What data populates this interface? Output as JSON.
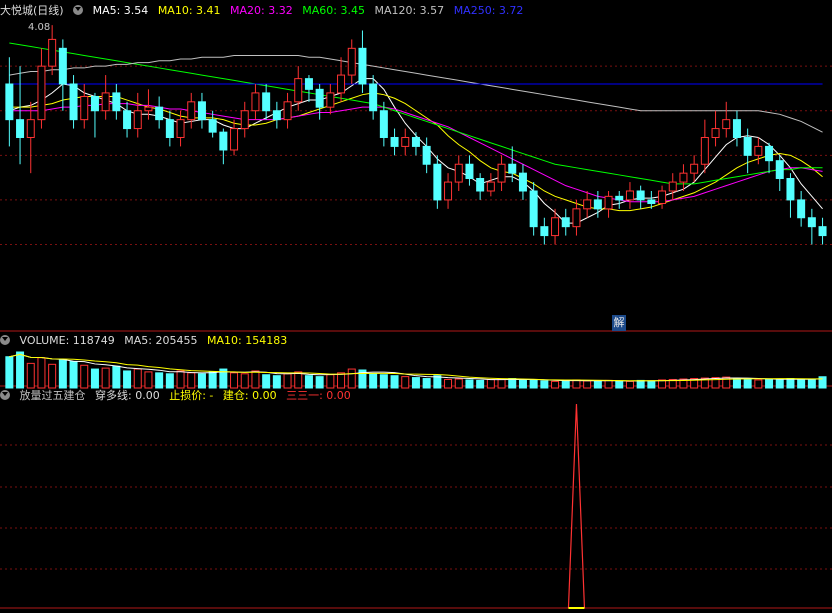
{
  "header": {
    "stock_name": "大悦城(日线)",
    "ma5": "MA5: 3.54",
    "ma10": "MA10: 3.41",
    "ma20": "MA20: 3.32",
    "ma60": "MA60: 3.45",
    "ma120": "MA120: 3.57",
    "ma250": "MA250: 3.72",
    "high_label": "4.08"
  },
  "volume_header": {
    "volume": "VOLUME: 118749",
    "ma5": "MA5: 205455",
    "ma10": "MA10: 154183"
  },
  "indicator_header": {
    "name": "放量过五建仓",
    "cross": "穿多线: 0.00",
    "stop": "止损价: -",
    "build": "建仓: 0.00",
    "three": "三三一: 0.00"
  },
  "badge": "解",
  "colors": {
    "up": "#ff3232",
    "down": "#54ffff",
    "ma5": "#ffffff",
    "ma10": "#ffff00",
    "ma20": "#ff00ff",
    "ma60": "#00ff00",
    "ma120": "#c0c0c0",
    "ma250": "#0000ff",
    "grid": "#7a1010",
    "indicator": "#ff3232"
  },
  "chart_data": {
    "type": "candlestick",
    "price_axis": {
      "ymin": 2.55,
      "ymax": 4.12
    },
    "price_grid_values": [
      3.85,
      3.6,
      3.35,
      3.1,
      2.85
    ],
    "candles": [
      [
        3.75,
        3.55,
        3.9,
        3.4
      ],
      [
        3.55,
        3.45,
        3.85,
        3.3
      ],
      [
        3.45,
        3.55,
        3.65,
        3.25
      ],
      [
        3.55,
        3.85,
        3.95,
        3.5
      ],
      [
        3.85,
        4.0,
        4.08,
        3.8
      ],
      [
        3.95,
        3.75,
        4.0,
        3.6
      ],
      [
        3.75,
        3.55,
        3.8,
        3.5
      ],
      [
        3.55,
        3.68,
        3.75,
        3.5
      ],
      [
        3.68,
        3.6,
        3.7,
        3.45
      ],
      [
        3.6,
        3.7,
        3.8,
        3.55
      ],
      [
        3.7,
        3.6,
        3.75,
        3.55
      ],
      [
        3.6,
        3.5,
        3.65,
        3.45
      ],
      [
        3.5,
        3.6,
        3.7,
        3.45
      ],
      [
        3.6,
        3.62,
        3.72,
        3.55
      ],
      [
        3.62,
        3.55,
        3.68,
        3.5
      ],
      [
        3.55,
        3.45,
        3.6,
        3.4
      ],
      [
        3.45,
        3.55,
        3.6,
        3.4
      ],
      [
        3.55,
        3.65,
        3.7,
        3.5
      ],
      [
        3.65,
        3.55,
        3.7,
        3.5
      ],
      [
        3.55,
        3.48,
        3.6,
        3.45
      ],
      [
        3.48,
        3.38,
        3.5,
        3.3
      ],
      [
        3.38,
        3.5,
        3.55,
        3.35
      ],
      [
        3.5,
        3.6,
        3.65,
        3.45
      ],
      [
        3.6,
        3.7,
        3.75,
        3.55
      ],
      [
        3.7,
        3.6,
        3.75,
        3.55
      ],
      [
        3.6,
        3.55,
        3.65,
        3.5
      ],
      [
        3.55,
        3.65,
        3.7,
        3.5
      ],
      [
        3.65,
        3.78,
        3.85,
        3.6
      ],
      [
        3.78,
        3.72,
        3.8,
        3.65
      ],
      [
        3.72,
        3.62,
        3.75,
        3.55
      ],
      [
        3.62,
        3.7,
        3.75,
        3.58
      ],
      [
        3.7,
        3.8,
        3.9,
        3.65
      ],
      [
        3.8,
        3.95,
        4.0,
        3.75
      ],
      [
        3.95,
        3.75,
        4.05,
        3.7
      ],
      [
        3.75,
        3.6,
        3.8,
        3.55
      ],
      [
        3.6,
        3.45,
        3.65,
        3.4
      ],
      [
        3.45,
        3.4,
        3.5,
        3.35
      ],
      [
        3.4,
        3.45,
        3.5,
        3.35
      ],
      [
        3.45,
        3.4,
        3.48,
        3.35
      ],
      [
        3.4,
        3.3,
        3.45,
        3.25
      ],
      [
        3.3,
        3.1,
        3.35,
        3.05
      ],
      [
        3.1,
        3.2,
        3.25,
        3.05
      ],
      [
        3.2,
        3.3,
        3.35,
        3.15
      ],
      [
        3.3,
        3.22,
        3.35,
        3.18
      ],
      [
        3.22,
        3.15,
        3.25,
        3.1
      ],
      [
        3.15,
        3.2,
        3.25,
        3.12
      ],
      [
        3.2,
        3.3,
        3.35,
        3.15
      ],
      [
        3.3,
        3.25,
        3.4,
        3.2
      ],
      [
        3.25,
        3.15,
        3.3,
        3.1
      ],
      [
        3.15,
        2.95,
        3.2,
        2.9
      ],
      [
        2.95,
        2.9,
        3.0,
        2.85
      ],
      [
        2.9,
        3.0,
        3.05,
        2.85
      ],
      [
        3.0,
        2.95,
        3.05,
        2.9
      ],
      [
        2.95,
        3.05,
        3.1,
        2.9
      ],
      [
        3.05,
        3.1,
        3.15,
        3.0
      ],
      [
        3.1,
        3.05,
        3.15,
        3.0
      ],
      [
        3.05,
        3.12,
        3.15,
        3.0
      ],
      [
        3.12,
        3.1,
        3.15,
        3.05
      ],
      [
        3.1,
        3.15,
        3.2,
        3.05
      ],
      [
        3.15,
        3.1,
        3.18,
        3.05
      ],
      [
        3.1,
        3.08,
        3.15,
        3.05
      ],
      [
        3.08,
        3.15,
        3.18,
        3.05
      ],
      [
        3.15,
        3.2,
        3.25,
        3.1
      ],
      [
        3.2,
        3.25,
        3.3,
        3.15
      ],
      [
        3.25,
        3.3,
        3.35,
        3.2
      ],
      [
        3.3,
        3.45,
        3.55,
        3.25
      ],
      [
        3.45,
        3.5,
        3.6,
        3.4
      ],
      [
        3.5,
        3.55,
        3.65,
        3.45
      ],
      [
        3.55,
        3.45,
        3.6,
        3.4
      ],
      [
        3.45,
        3.35,
        3.5,
        3.25
      ],
      [
        3.35,
        3.4,
        3.45,
        3.3
      ],
      [
        3.4,
        3.32,
        3.42,
        3.25
      ],
      [
        3.32,
        3.22,
        3.35,
        3.15
      ],
      [
        3.22,
        3.1,
        3.25,
        3.0
      ],
      [
        3.1,
        3.0,
        3.15,
        2.95
      ],
      [
        3.0,
        2.95,
        3.05,
        2.85
      ],
      [
        2.95,
        2.9,
        3.0,
        2.85
      ]
    ],
    "moving_averages": {
      "ma5": [
        3.6,
        3.62,
        3.63,
        3.66,
        3.7,
        3.75,
        3.74,
        3.7,
        3.68,
        3.66,
        3.64,
        3.6,
        3.58,
        3.58,
        3.57,
        3.55,
        3.53,
        3.54,
        3.55,
        3.55,
        3.52,
        3.5,
        3.5,
        3.53,
        3.56,
        3.59,
        3.62,
        3.64,
        3.66,
        3.66,
        3.68,
        3.7,
        3.74,
        3.78,
        3.78,
        3.72,
        3.62,
        3.53,
        3.46,
        3.4,
        3.33,
        3.28,
        3.26,
        3.23,
        3.19,
        3.21,
        3.23,
        3.23,
        3.2,
        3.15,
        3.08,
        3.03,
        2.97,
        2.97,
        3.0,
        3.03,
        3.07,
        3.08,
        3.1,
        3.11,
        3.11,
        3.12,
        3.14,
        3.16,
        3.2,
        3.27,
        3.34,
        3.41,
        3.45,
        3.46,
        3.45,
        3.41,
        3.35,
        3.28,
        3.19,
        3.12,
        3.05
      ],
      "ma10": [
        3.62,
        3.62,
        3.62,
        3.63,
        3.64,
        3.66,
        3.67,
        3.68,
        3.68,
        3.68,
        3.68,
        3.66,
        3.64,
        3.62,
        3.61,
        3.59,
        3.57,
        3.56,
        3.56,
        3.56,
        3.55,
        3.53,
        3.52,
        3.52,
        3.53,
        3.55,
        3.56,
        3.57,
        3.59,
        3.61,
        3.63,
        3.65,
        3.67,
        3.69,
        3.7,
        3.69,
        3.67,
        3.64,
        3.6,
        3.56,
        3.52,
        3.46,
        3.41,
        3.37,
        3.32,
        3.28,
        3.26,
        3.25,
        3.22,
        3.19,
        3.15,
        3.12,
        3.1,
        3.08,
        3.06,
        3.05,
        3.05,
        3.04,
        3.04,
        3.05,
        3.06,
        3.08,
        3.1,
        3.12,
        3.14,
        3.17,
        3.2,
        3.24,
        3.28,
        3.31,
        3.33,
        3.35,
        3.36,
        3.35,
        3.32,
        3.28,
        3.23
      ],
      "ma20": [
        3.6,
        3.6,
        3.6,
        3.6,
        3.61,
        3.62,
        3.62,
        3.63,
        3.63,
        3.64,
        3.64,
        3.64,
        3.63,
        3.63,
        3.62,
        3.61,
        3.61,
        3.6,
        3.59,
        3.58,
        3.57,
        3.56,
        3.55,
        3.55,
        3.55,
        3.55,
        3.56,
        3.57,
        3.58,
        3.59,
        3.59,
        3.6,
        3.61,
        3.62,
        3.62,
        3.62,
        3.61,
        3.59,
        3.57,
        3.55,
        3.53,
        3.51,
        3.48,
        3.45,
        3.42,
        3.39,
        3.36,
        3.33,
        3.3,
        3.27,
        3.24,
        3.21,
        3.18,
        3.16,
        3.14,
        3.12,
        3.11,
        3.1,
        3.09,
        3.09,
        3.09,
        3.09,
        3.1,
        3.11,
        3.12,
        3.14,
        3.16,
        3.18,
        3.2,
        3.22,
        3.24,
        3.26,
        3.27,
        3.28,
        3.28,
        3.27,
        3.26
      ],
      "ma60": [
        3.98,
        3.97,
        3.96,
        3.95,
        3.94,
        3.93,
        3.92,
        3.91,
        3.9,
        3.89,
        3.88,
        3.87,
        3.86,
        3.85,
        3.84,
        3.83,
        3.82,
        3.81,
        3.8,
        3.79,
        3.78,
        3.77,
        3.76,
        3.75,
        3.74,
        3.73,
        3.72,
        3.71,
        3.7,
        3.69,
        3.68,
        3.67,
        3.66,
        3.65,
        3.64,
        3.62,
        3.6,
        3.58,
        3.56,
        3.54,
        3.52,
        3.5,
        3.48,
        3.46,
        3.44,
        3.42,
        3.4,
        3.38,
        3.36,
        3.34,
        3.32,
        3.3,
        3.29,
        3.28,
        3.27,
        3.26,
        3.25,
        3.24,
        3.23,
        3.22,
        3.21,
        3.2,
        3.19,
        3.19,
        3.19,
        3.2,
        3.21,
        3.22,
        3.23,
        3.24,
        3.25,
        3.26,
        3.27,
        3.27,
        3.28,
        3.28,
        3.28
      ],
      "ma120": [
        3.8,
        3.81,
        3.82,
        3.82,
        3.83,
        3.83,
        3.84,
        3.84,
        3.85,
        3.85,
        3.86,
        3.86,
        3.87,
        3.87,
        3.88,
        3.88,
        3.89,
        3.89,
        3.9,
        3.9,
        3.9,
        3.91,
        3.91,
        3.91,
        3.91,
        3.91,
        3.91,
        3.91,
        3.9,
        3.9,
        3.89,
        3.88,
        3.87,
        3.86,
        3.85,
        3.84,
        3.83,
        3.82,
        3.81,
        3.8,
        3.79,
        3.78,
        3.77,
        3.76,
        3.75,
        3.74,
        3.73,
        3.72,
        3.71,
        3.7,
        3.69,
        3.68,
        3.67,
        3.66,
        3.65,
        3.64,
        3.63,
        3.62,
        3.61,
        3.6,
        3.6,
        3.6,
        3.6,
        3.6,
        3.6,
        3.6,
        3.6,
        3.6,
        3.6,
        3.6,
        3.6,
        3.59,
        3.58,
        3.56,
        3.54,
        3.51,
        3.48
      ],
      "ma250": [
        3.75,
        3.75,
        3.75,
        3.75,
        3.75,
        3.75,
        3.75,
        3.75,
        3.75,
        3.75,
        3.75,
        3.75,
        3.75,
        3.75,
        3.75,
        3.75,
        3.75,
        3.75,
        3.75,
        3.75,
        3.75,
        3.75,
        3.75,
        3.75,
        3.75,
        3.75,
        3.75,
        3.75,
        3.75,
        3.75,
        3.75,
        3.75,
        3.75,
        3.75,
        3.75,
        3.75,
        3.75,
        3.75,
        3.75,
        3.75,
        3.75,
        3.75,
        3.75,
        3.75,
        3.75,
        3.75,
        3.75,
        3.75,
        3.75,
        3.75,
        3.75,
        3.75,
        3.75,
        3.75,
        3.75,
        3.75,
        3.75,
        3.75,
        3.75,
        3.75,
        3.75,
        3.75,
        3.75,
        3.75,
        3.75,
        3.75,
        3.75,
        3.75,
        3.75,
        3.75,
        3.75,
        3.75,
        3.75,
        3.75,
        3.75,
        3.75,
        3.75
      ]
    },
    "volume_axis": {
      "ymax": 380000
    },
    "volume": [
      330000,
      380000,
      260000,
      320000,
      250000,
      300000,
      280000,
      240000,
      200000,
      210000,
      230000,
      180000,
      200000,
      170000,
      160000,
      150000,
      180000,
      160000,
      150000,
      170000,
      200000,
      160000,
      150000,
      180000,
      140000,
      130000,
      150000,
      170000,
      130000,
      120000,
      140000,
      160000,
      200000,
      190000,
      150000,
      140000,
      130000,
      120000,
      110000,
      100000,
      130000,
      90000,
      95000,
      85000,
      80000,
      90000,
      95000,
      100000,
      85000,
      80000,
      75000,
      70000,
      80000,
      85000,
      75000,
      70000,
      80000,
      75000,
      70000,
      80000,
      75000,
      85000,
      90000,
      95000,
      100000,
      105000,
      110000,
      115000,
      100000,
      90000,
      85000,
      90000,
      95000,
      100000,
      90000,
      85000,
      118749
    ],
    "indicator": {
      "signal_index": 53,
      "signal_value": 1
    }
  }
}
